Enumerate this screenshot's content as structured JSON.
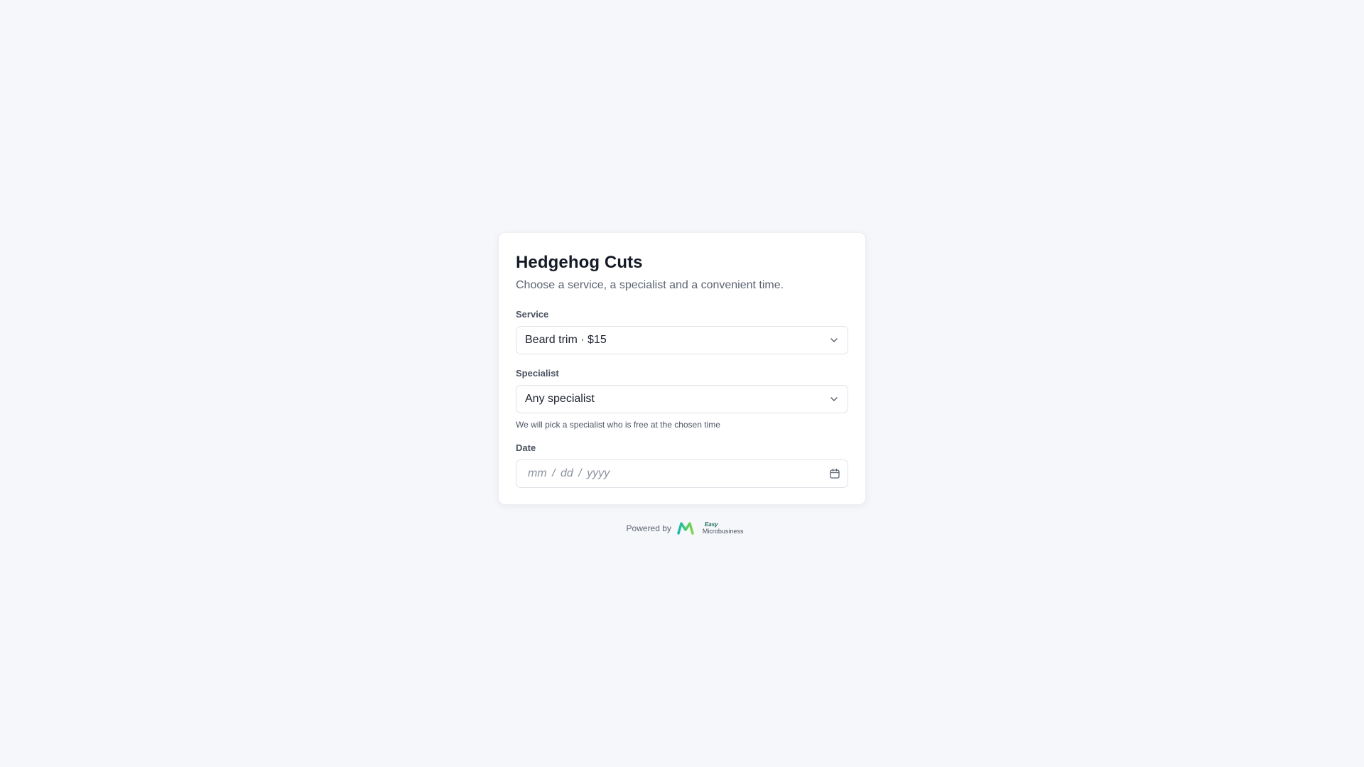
{
  "form": {
    "title": "Hedgehog Cuts",
    "subtitle": "Choose a service, a specialist and a convenient time.",
    "service": {
      "label": "Service",
      "value": "Beard trim · $15"
    },
    "specialist": {
      "label": "Specialist",
      "value": "Any specialist",
      "hint": "We will pick a specialist who is free at the chosen time"
    },
    "date": {
      "label": "Date",
      "placeholder": "mm / dd / yyyy"
    }
  },
  "footer": {
    "powered_by": "Powered by",
    "logo_easy": "Easy",
    "logo_name": "Microbusiness"
  },
  "icons": {
    "service_select": "chevron-down-icon",
    "specialist_select": "chevron-down-icon",
    "date_picker": "calendar-icon",
    "brand": "microbusiness-logo-icon"
  },
  "colors": {
    "background": "#f6f7fa",
    "card": "#ffffff",
    "logo_teal": "#19b8b0",
    "logo_green": "#7cd63b"
  }
}
